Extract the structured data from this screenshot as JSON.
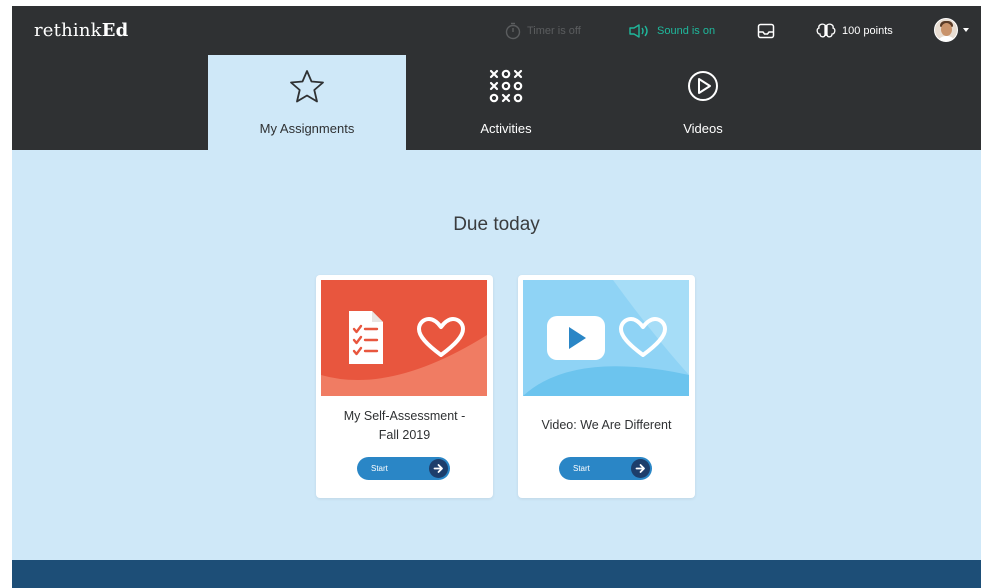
{
  "app": {
    "logo_light": "rethink",
    "logo_bold": "Ed"
  },
  "toolbar": {
    "timer": {
      "label": "Timer is off",
      "icon": "stopwatch-icon",
      "color": "#5b5d5f"
    },
    "sound": {
      "label": "Sound is on",
      "icon": "speaker-icon",
      "color": "#1fb89c"
    },
    "inbox": {
      "icon": "inbox-icon"
    },
    "points": {
      "label": "100 points",
      "icon": "brain-icon"
    },
    "profile": {
      "icon": "avatar"
    }
  },
  "tabs": [
    {
      "label": "My Assignments",
      "icon": "star-icon",
      "active": true
    },
    {
      "label": "Activities",
      "icon": "tic-tac-toe-icon",
      "active": false
    },
    {
      "label": "Videos",
      "icon": "play-circle-icon",
      "active": false
    }
  ],
  "main": {
    "heading": "Due today",
    "cards": [
      {
        "title_line1": "My Self-Assessment  -",
        "title_line2": "Fall 2019",
        "button": "Start",
        "thumbnail_color": "#e8563e",
        "icons": [
          "checklist-document-icon",
          "heart-icon"
        ]
      },
      {
        "title_line1": "Video: We Are Different",
        "button": "Start",
        "thumbnail_color": "#6cc4ee",
        "icons": [
          "video-play-icon",
          "heart-icon"
        ]
      }
    ]
  },
  "colors": {
    "topbar": "#2f3133",
    "content_bg": "#cfe8f8",
    "accent_blue": "#2a86c6",
    "footer": "#1d4e77"
  }
}
